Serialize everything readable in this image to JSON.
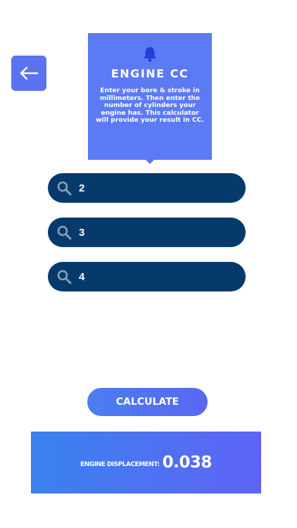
{
  "header": {
    "back_icon": "arrow-left-icon",
    "info_icon": "bell-icon",
    "title": "ENGINE CC",
    "description": "Enter your bore & stroke in millimeters.  Then enter the number of cylinders your engine has.  This calculator will provide your result in CC."
  },
  "fields": [
    {
      "icon": "search-icon",
      "value": "2",
      "placeholder": ""
    },
    {
      "icon": "search-icon",
      "value": "3",
      "placeholder": ""
    },
    {
      "icon": "search-icon",
      "value": "4",
      "placeholder": ""
    }
  ],
  "calculate_label": "CALCULATE",
  "result": {
    "label": "ENGINE DISPLACEMENT:",
    "value": "0.038"
  },
  "colors": {
    "accent": "#5c7af4",
    "field_bg": "#073a6c",
    "text": "#ffffff"
  }
}
